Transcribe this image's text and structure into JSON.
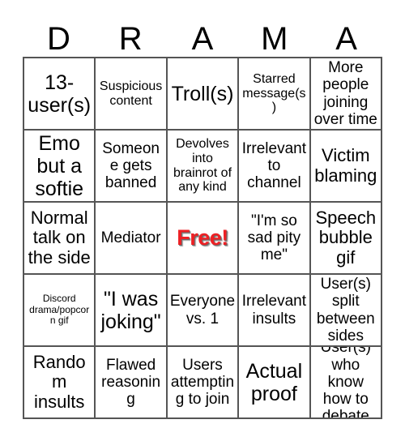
{
  "card": {
    "header_letters": [
      "D",
      "R",
      "A",
      "M",
      "A"
    ],
    "columns": 5,
    "rows": 5,
    "free_space": {
      "row": 2,
      "col": 2,
      "label": "Free!",
      "color": "#ed2024"
    },
    "border_color": "#555555",
    "background_color": "#ffffff",
    "text_color": "#000000",
    "cells": [
      {
        "text": "13-user(s)",
        "size": "fs-xl"
      },
      {
        "text": "Suspicious content",
        "size": "fs-sm"
      },
      {
        "text": "Troll(s)",
        "size": "fs-xl"
      },
      {
        "text": "Starred message(s)",
        "size": "fs-sm"
      },
      {
        "text": "More people joining over time",
        "size": "fs-md"
      },
      {
        "text": "Emo but a softie",
        "size": "fs-xl"
      },
      {
        "text": "Someone gets banned",
        "size": "fs-md"
      },
      {
        "text": "Devolves into brainrot of any kind",
        "size": "fs-sm"
      },
      {
        "text": "Irrelevant to channel",
        "size": "fs-md"
      },
      {
        "text": "Victim blaming",
        "size": "fs-lg"
      },
      {
        "text": "Normal talk on the side",
        "size": "fs-lg"
      },
      {
        "text": "Mediator",
        "size": "fs-md"
      },
      {
        "text": "Free!",
        "size": "free"
      },
      {
        "text": "\"I'm so sad pity me\"",
        "size": "fs-md"
      },
      {
        "text": "Speech bubble gif",
        "size": "fs-lg"
      },
      {
        "text": "Discord drama/popcorn gif",
        "size": "fs-xs"
      },
      {
        "text": "\"I was joking\"",
        "size": "fs-xl"
      },
      {
        "text": "Everyone vs. 1",
        "size": "fs-md"
      },
      {
        "text": "Irrelevant insults",
        "size": "fs-md"
      },
      {
        "text": "User(s) split between sides",
        "size": "fs-md"
      },
      {
        "text": "Random insults",
        "size": "fs-lg"
      },
      {
        "text": "Flawed reasoning",
        "size": "fs-md"
      },
      {
        "text": "Users attempting to join",
        "size": "fs-md"
      },
      {
        "text": "Actual proof",
        "size": "fs-xl"
      },
      {
        "text": "User(s) who know how to debate",
        "size": "fs-md"
      }
    ]
  }
}
